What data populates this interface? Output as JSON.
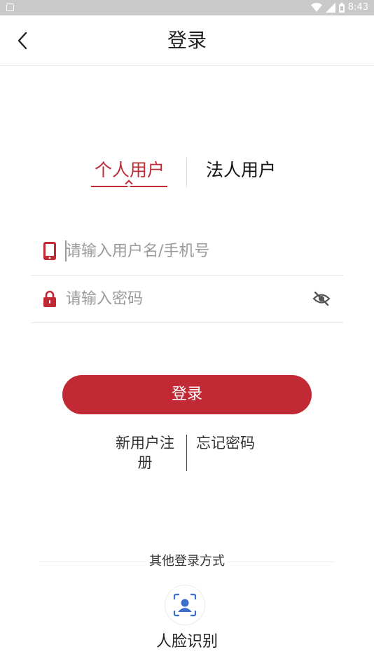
{
  "status_bar": {
    "time": "8:43"
  },
  "header": {
    "title": "登录"
  },
  "tabs": [
    {
      "label": "个人用户",
      "active": true
    },
    {
      "label": "法人用户",
      "active": false
    }
  ],
  "form": {
    "username_placeholder": "请输入用户名/手机号",
    "password_placeholder": "请输入密码"
  },
  "login_button": {
    "label": "登录"
  },
  "links": {
    "register": "新用户注册",
    "forgot": "忘记密码"
  },
  "other_login": {
    "title": "其他登录方式",
    "face_label": "人脸识别"
  },
  "colors": {
    "accent": "#c12a35",
    "face_icon": "#3d6fc9"
  },
  "icons": {
    "back": "chevron-left-icon",
    "phone": "phone-icon",
    "lock": "lock-icon",
    "eye": "eye-off-icon",
    "face": "face-scan-icon"
  }
}
